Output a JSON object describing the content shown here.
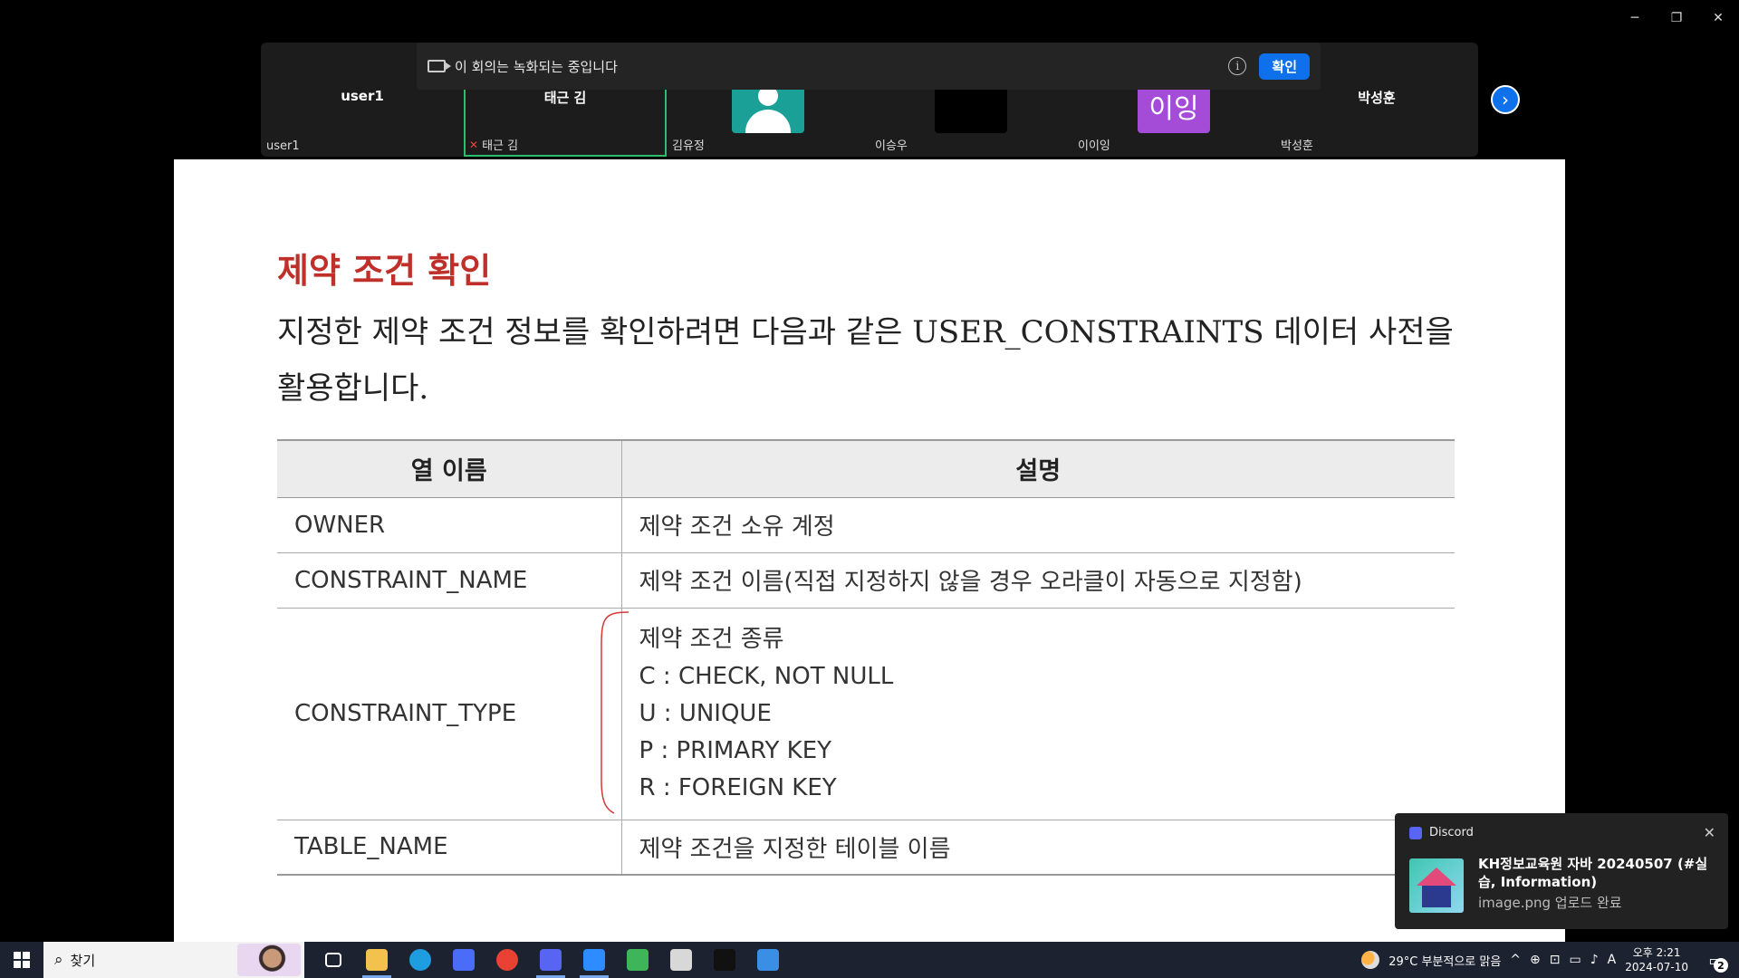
{
  "window": {
    "controls": [
      "─",
      "❐",
      "✕"
    ]
  },
  "participants": [
    {
      "center_label": "user1",
      "corner_label": "user1",
      "kind": "name"
    },
    {
      "center_label": "태근 김",
      "corner_label": "태근 김",
      "kind": "name",
      "active": true,
      "mic_muted": true
    },
    {
      "center_label": "",
      "corner_label": "김유정",
      "kind": "avatar-person"
    },
    {
      "center_label": "",
      "corner_label": "이승우",
      "kind": "video-black"
    },
    {
      "center_label": "이잉",
      "corner_label": "이이잉",
      "kind": "avatar-initials"
    },
    {
      "center_label": "박성훈",
      "corner_label": "박성훈",
      "kind": "name"
    }
  ],
  "recording_bar": {
    "text": "이 회의는 녹화되는 중입니다",
    "info_glyph": "i",
    "confirm_label": "확인"
  },
  "next_arrow": "›",
  "slide": {
    "title": "제약 조건 확인",
    "body": "지정한 제약 조건 정보를 확인하려면 다음과 같은 USER_CONSTRAINTS 데이터 사전을 활용합니다.",
    "table": {
      "headers": [
        "열 이름",
        "설명"
      ],
      "rows": [
        {
          "name": "OWNER",
          "desc": [
            "제약 조건 소유 계정"
          ]
        },
        {
          "name": "CONSTRAINT_NAME",
          "desc": [
            "제약 조건 이름(직접 지정하지 않을 경우 오라클이 자동으로 지정함)"
          ]
        },
        {
          "name": "CONSTRAINT_TYPE",
          "desc": [
            "제약 조건 종류",
            "C : CHECK, NOT NULL",
            "U : UNIQUE",
            "P : PRIMARY KEY",
            "R : FOREIGN KEY"
          ]
        },
        {
          "name": "TABLE_NAME",
          "desc": [
            "제약 조건을 지정한 테이블 이름"
          ]
        }
      ]
    },
    "annotation_color": "#d23a3a"
  },
  "toast": {
    "app": "Discord",
    "title": "KH정보교육원 자바 20240507 (#실습, Information)",
    "subtitle": "image.png 업로드 완료",
    "close_glyph": "✕"
  },
  "taskbar": {
    "search_placeholder": "찾기",
    "apps": [
      {
        "name": "task-view",
        "color": "#1c2230",
        "active": false
      },
      {
        "name": "file-explorer",
        "color": "#f2c14e",
        "active": true
      },
      {
        "name": "edge",
        "color": "#1e9de0",
        "active": false
      },
      {
        "name": "store",
        "color": "#4a6cf7",
        "active": false
      },
      {
        "name": "chrome",
        "color": "#e94235",
        "active": false
      },
      {
        "name": "discord",
        "color": "#5865f2",
        "active": true
      },
      {
        "name": "zoom",
        "color": "#2d8cff",
        "active": true
      },
      {
        "name": "media",
        "color": "#3fb55a",
        "active": false
      },
      {
        "name": "notepad",
        "color": "#d8d8d8",
        "active": false
      },
      {
        "name": "terminal",
        "color": "#111111",
        "active": false
      },
      {
        "name": "paint",
        "color": "#3a8ee6",
        "active": false
      }
    ],
    "weather": "29°C  부분적으로 맑음",
    "tray_glyphs": [
      "^",
      "⊕",
      "⊡",
      "▭",
      "♪",
      "A"
    ],
    "time": "오후 2:21",
    "date": "2024-07-10",
    "notifications_count": "2"
  }
}
